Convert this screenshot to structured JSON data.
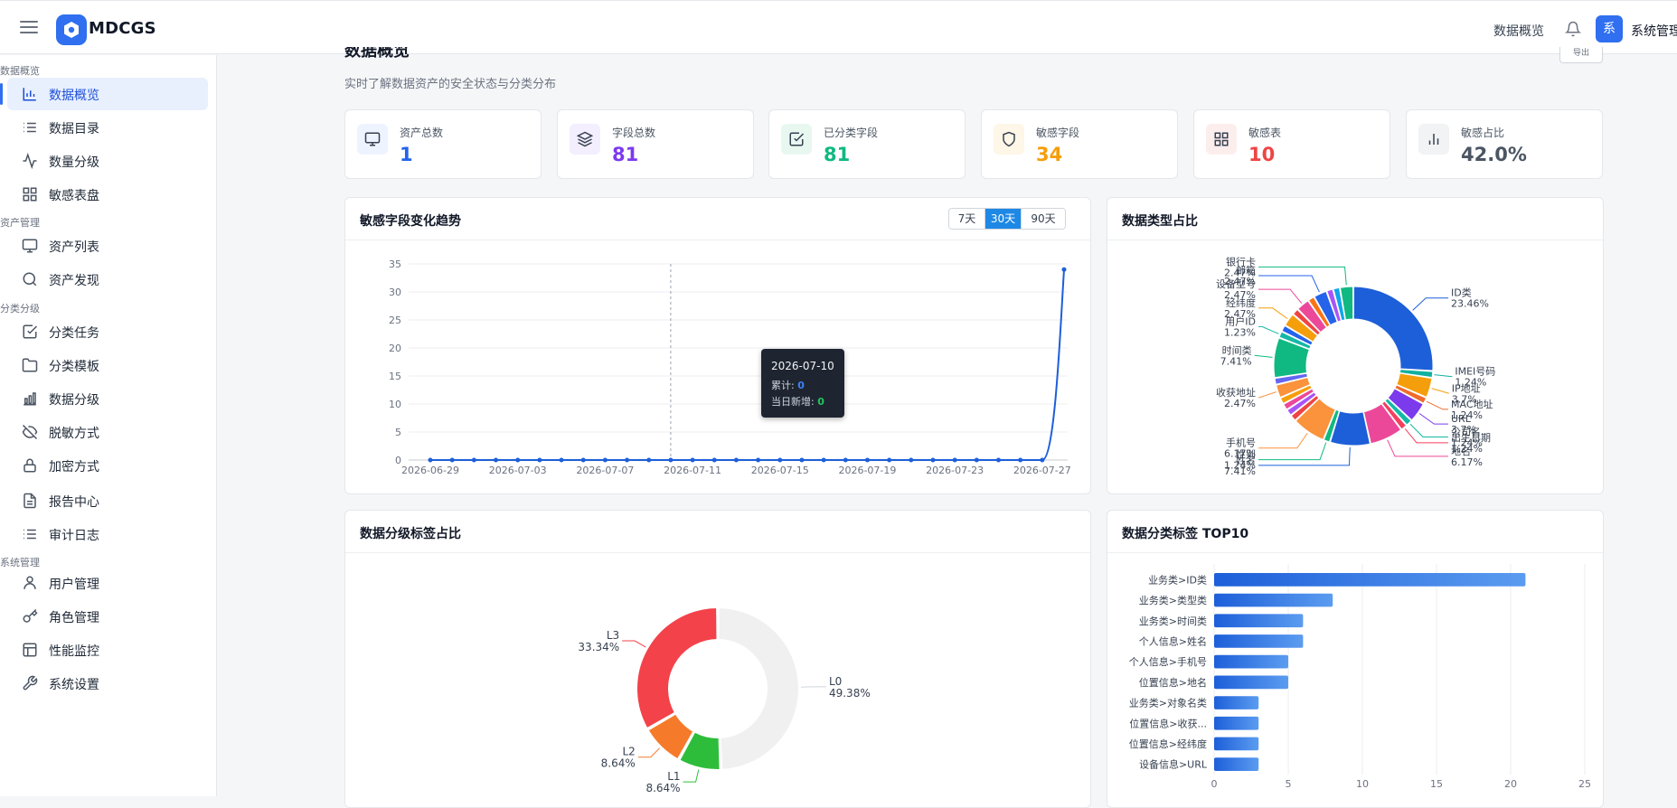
{
  "app": {
    "name": "MDCGS"
  },
  "header": {
    "overview_link": "数据概览",
    "user_avatar_char": "系",
    "user_name": "系统管理"
  },
  "sidebar": {
    "sections": [
      {
        "title": "数据概览",
        "items": [
          {
            "label": "数据概览",
            "icon": "bar-chart-icon",
            "active": true
          },
          {
            "label": "数据目录",
            "icon": "list-icon"
          },
          {
            "label": "数量分级",
            "icon": "activity-icon"
          },
          {
            "label": "敏感表盘",
            "icon": "grid-icon"
          }
        ]
      },
      {
        "title": "资产管理",
        "items": [
          {
            "label": "资产列表",
            "icon": "monitor-icon"
          },
          {
            "label": "资产发现",
            "icon": "search-icon"
          }
        ]
      },
      {
        "title": "分类分级",
        "items": [
          {
            "label": "分类任务",
            "icon": "check-square-icon"
          },
          {
            "label": "分类模板",
            "icon": "folder-icon"
          },
          {
            "label": "数据分级",
            "icon": "bar-levels-icon"
          },
          {
            "label": "脱敏方式",
            "icon": "eye-off-icon"
          },
          {
            "label": "加密方式",
            "icon": "lock-icon"
          },
          {
            "label": "报告中心",
            "icon": "file-icon"
          },
          {
            "label": "审计日志",
            "icon": "list-icon"
          }
        ]
      },
      {
        "title": "系统管理",
        "items": [
          {
            "label": "用户管理",
            "icon": "user-icon"
          },
          {
            "label": "角色管理",
            "icon": "key-icon"
          },
          {
            "label": "性能监控",
            "icon": "table-icon"
          },
          {
            "label": "系统设置",
            "icon": "wrench-icon"
          }
        ]
      }
    ]
  },
  "page": {
    "title": "数据概览",
    "subtitle": "实时了解数据资产的安全状态与分类分布",
    "export_label": "导出"
  },
  "stats": [
    {
      "label": "资产总数",
      "value": "1",
      "color": "#2563eb",
      "bg": "#eef4ff",
      "icon": "monitor-icon"
    },
    {
      "label": "字段总数",
      "value": "81",
      "color": "#7c3aed",
      "bg": "#f3effe",
      "icon": "layers-icon"
    },
    {
      "label": "已分类字段",
      "value": "81",
      "color": "#10b981",
      "bg": "#e8f8f1",
      "icon": "check-square-icon"
    },
    {
      "label": "敏感字段",
      "value": "34",
      "color": "#f59e0b",
      "bg": "#fef6e6",
      "icon": "shield-icon"
    },
    {
      "label": "敏感表",
      "value": "10",
      "color": "#ef4444",
      "bg": "#fdeeee",
      "icon": "grid-icon"
    },
    {
      "label": "敏感占比",
      "value": "42.0%",
      "color": "#4b5563",
      "bg": "#f1f3f5",
      "icon": "bar-chart-icon"
    }
  ],
  "trend": {
    "title": "敏感字段变化趋势",
    "ranges": [
      "7天",
      "30天",
      "90天"
    ],
    "active_range": "30天",
    "tooltip": {
      "date": "2026-07-10",
      "cum_label": "累计:",
      "cum_value": "0",
      "new_label": "当日新增:",
      "new_value": "0"
    }
  },
  "type_chart": {
    "title": "数据类型占比"
  },
  "level_chart": {
    "title": "数据分级标签占比"
  },
  "top10_chart": {
    "title": "数据分类标签 TOP10"
  },
  "chart_data": [
    {
      "type": "line",
      "x": [
        "2026-06-29",
        "2026-06-30",
        "2026-07-01",
        "2026-07-02",
        "2026-07-03",
        "2026-07-04",
        "2026-07-05",
        "2026-07-06",
        "2026-07-07",
        "2026-07-08",
        "2026-07-09",
        "2026-07-10",
        "2026-07-11",
        "2026-07-12",
        "2026-07-13",
        "2026-07-14",
        "2026-07-15",
        "2026-07-16",
        "2026-07-17",
        "2026-07-18",
        "2026-07-19",
        "2026-07-20",
        "2026-07-21",
        "2026-07-22",
        "2026-07-23",
        "2026-07-24",
        "2026-07-25",
        "2026-07-26",
        "2026-07-27",
        "2026-07-28"
      ],
      "y": [
        0,
        0,
        0,
        0,
        0,
        0,
        0,
        0,
        0,
        0,
        0,
        0,
        0,
        0,
        0,
        0,
        0,
        0,
        0,
        0,
        0,
        0,
        0,
        0,
        0,
        0,
        0,
        0,
        0,
        34
      ],
      "xticks": [
        "2026-06-29",
        "2026-07-03",
        "2026-07-07",
        "2026-07-11",
        "2026-07-15",
        "2026-07-19",
        "2026-07-23",
        "2026-07-27"
      ],
      "yticks": [
        0,
        5,
        10,
        15,
        20,
        25,
        30,
        35
      ],
      "ylim": [
        0,
        35
      ],
      "color": "#1d5fd9",
      "grid": true
    },
    {
      "type": "pie",
      "labels": [
        "ID类",
        "IMEI号码",
        "IP地址",
        "MAC地址",
        "URL",
        "公司名",
        "出生日期",
        "地名",
        "姓名",
        "性别",
        "手机号",
        "",
        "",
        "",
        "",
        "收获地址",
        "",
        "时间类",
        "用户ID",
        "",
        "经纬度",
        "",
        "设备型号",
        "",
        "邮箱",
        "",
        "",
        "银行卡"
      ],
      "values": [
        23.46,
        1.24,
        3.7,
        1.24,
        3.7,
        1.24,
        1.24,
        6.17,
        7.41,
        1.24,
        6.17,
        1.24,
        1.24,
        1.24,
        1.24,
        2.47,
        1.24,
        7.41,
        1.23,
        1.24,
        2.47,
        1.24,
        2.47,
        1.24,
        2.47,
        1.24,
        1.24,
        2.47
      ],
      "colors": [
        "#1d5fd9",
        "#10b0a0",
        "#f59e0b",
        "#ef6c2c",
        "#7c3aed",
        "#14b8a6",
        "#f43f5e",
        "#ec4899",
        "#1d5fd9",
        "#10b981",
        "#fb923c",
        "#ef4444",
        "#a855f7",
        "#ec4899",
        "#f59e0b",
        "#fb923c",
        "#6366f1",
        "#10b981",
        "#14b8a6",
        "#2563eb",
        "#f59e0b",
        "#ef4444",
        "#ec4899",
        "#f97316",
        "#2563eb",
        "#a855f7",
        "#0ea5e9",
        "#10b981"
      ],
      "donut": true
    },
    {
      "type": "pie",
      "labels": [
        "L0",
        "L1",
        "L2",
        "L3"
      ],
      "values": [
        49.38,
        8.64,
        8.64,
        33.34
      ],
      "colors": [
        "#f0f0f0",
        "#2ebd3a",
        "#f57b2a",
        "#f3424a"
      ],
      "donut": true
    },
    {
      "type": "bar",
      "orientation": "horizontal",
      "categories": [
        "业务类>ID类",
        "业务类>类型类",
        "业务类>时间类",
        "个人信息>姓名",
        "个人信息>手机号",
        "位置信息>地名",
        "业务类>对象名类",
        "位置信息>收获...",
        "位置信息>经纬度",
        "设备信息>URL"
      ],
      "values": [
        21,
        8,
        6,
        6,
        5,
        5,
        3,
        3,
        3,
        3
      ],
      "xticks": [
        0,
        5,
        10,
        15,
        20,
        25
      ],
      "xlim": [
        0,
        25
      ],
      "color": "#2f6ff0",
      "grid": true
    }
  ]
}
